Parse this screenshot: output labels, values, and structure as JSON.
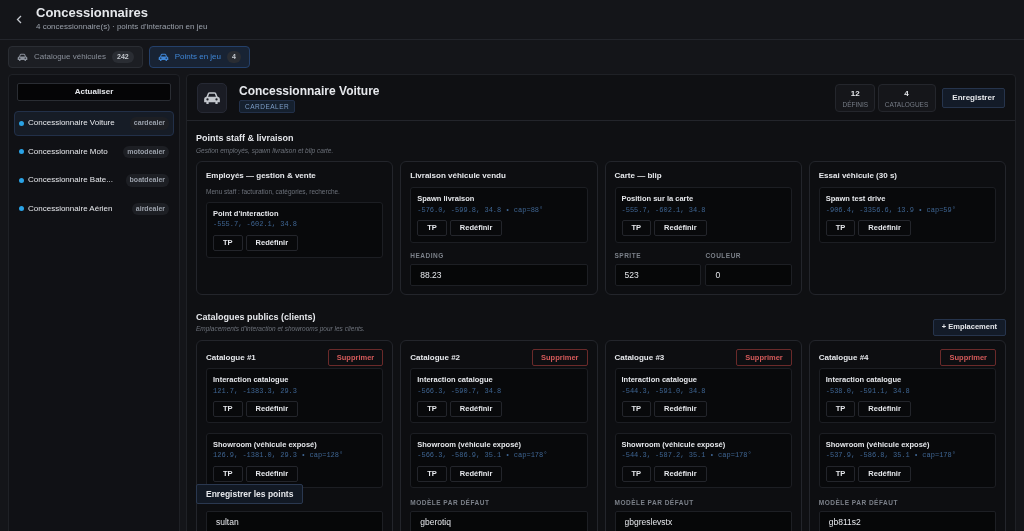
{
  "header": {
    "title": "Concessionnaires",
    "subtitle": "4 concessionnaire(s) · points d'interaction en jeu"
  },
  "tabs": [
    {
      "label": "Catalogue véhicules",
      "count": "242",
      "selected": false
    },
    {
      "label": "Points en jeu",
      "count": "4",
      "selected": true
    }
  ],
  "sidebar": {
    "refresh_button": "Actualiser",
    "items": [
      {
        "name": "Concessionnaire Voiture",
        "tag": "cardealer",
        "selected": true
      },
      {
        "name": "Concessionnaire Moto",
        "tag": "motodealer",
        "selected": false
      },
      {
        "name": "Concessionnaire Bate...",
        "tag": "boatdealer",
        "selected": false
      },
      {
        "name": "Concessionnaire Aérien",
        "tag": "airdealer",
        "selected": false
      }
    ]
  },
  "dealer": {
    "title": "Concessionnaire Voiture",
    "badge": "CARDEALER",
    "stats": [
      {
        "value": "12",
        "label": "DÉFINIS"
      },
      {
        "value": "4",
        "label": "CATALOGUES"
      }
    ],
    "save_button": "Enregistrer"
  },
  "staff_section": {
    "title": "Points staff & livraison",
    "subtitle": "Gestion employés, spawn livraison et blip carte.",
    "cards": [
      {
        "title": "Employés — gestion & vente",
        "description": "Menu staff : facturation, catégories, recherche.",
        "points": [
          {
            "label": "Point d'interaction",
            "coords": "-555.7, -602.1, 34.8",
            "buttons": [
              "TP",
              "Redéfinir"
            ]
          }
        ]
      },
      {
        "title": "Livraison véhicule vendu",
        "points": [
          {
            "label": "Spawn livraison",
            "coords": "-576.0, -599.8, 34.8 • cap=88°",
            "buttons": [
              "TP",
              "Redéfinir"
            ]
          }
        ],
        "fields": [
          {
            "label": "HEADING",
            "value": "88.23"
          }
        ]
      },
      {
        "title": "Carte — blip",
        "points": [
          {
            "label": "Position sur la carte",
            "coords": "-555.7, -602.1, 34.8",
            "buttons": [
              "TP",
              "Redéfinir"
            ]
          }
        ],
        "fields": [
          {
            "label": "SPRITE",
            "value": "523"
          },
          {
            "label": "COULEUR",
            "value": "0"
          }
        ]
      },
      {
        "title": "Essai véhicule (30 s)",
        "points": [
          {
            "label": "Spawn test drive",
            "coords": "-906.4, -3356.6, 13.9 • cap=59°",
            "buttons": [
              "TP",
              "Redéfinir"
            ]
          }
        ]
      }
    ]
  },
  "catalog_section": {
    "title": "Catalogues publics (clients)",
    "subtitle": "Emplacements d'interaction et showrooms pour les clients.",
    "add_button": "+ Emplacement",
    "catalogs": [
      {
        "title": "Catalogue #1",
        "delete_button": "Supprimer",
        "points": [
          {
            "label": "Interaction catalogue",
            "coords": "121.7, -1383.3, 29.3",
            "buttons": [
              "TP",
              "Redéfinir"
            ]
          },
          {
            "label": "Showroom (véhicule exposé)",
            "coords": "126.9, -1381.0, 29.3 • cap=128°",
            "buttons": [
              "TP",
              "Redéfinir"
            ]
          }
        ],
        "model_value": "sultan"
      },
      {
        "title": "Catalogue #2",
        "delete_button": "Supprimer",
        "points": [
          {
            "label": "Interaction catalogue",
            "coords": "-566.3, -590.7, 34.8",
            "buttons": [
              "TP",
              "Redéfinir"
            ]
          },
          {
            "label": "Showroom (véhicule exposé)",
            "coords": "-566.3, -586.9, 35.1 • cap=178°",
            "buttons": [
              "TP",
              "Redéfinir"
            ]
          }
        ],
        "model_label": "MODÈLE PAR DÉFAUT",
        "model_value": "gberotiq"
      },
      {
        "title": "Catalogue #3",
        "delete_button": "Supprimer",
        "points": [
          {
            "label": "Interaction catalogue",
            "coords": "-544.3, -591.0, 34.8",
            "buttons": [
              "TP",
              "Redéfinir"
            ]
          },
          {
            "label": "Showroom (véhicule exposé)",
            "coords": "-544.3, -587.2, 35.1 • cap=178°",
            "buttons": [
              "TP",
              "Redéfinir"
            ]
          }
        ],
        "model_label": "MODÈLE PAR DÉFAUT",
        "model_value": "gbgreslevstx"
      },
      {
        "title": "Catalogue #4",
        "delete_button": "Supprimer",
        "points": [
          {
            "label": "Interaction catalogue",
            "coords": "-538.0, -591.1, 34.8",
            "buttons": [
              "TP",
              "Redéfinir"
            ]
          },
          {
            "label": "Showroom (véhicule exposé)",
            "coords": "-537.9, -586.8, 35.1 • cap=178°",
            "buttons": [
              "TP",
              "Redéfinir"
            ]
          }
        ],
        "model_label": "MODÈLE PAR DÉFAUT",
        "model_value": "gb811s2"
      }
    ]
  },
  "floating_save_button": "Enregistrer les points"
}
